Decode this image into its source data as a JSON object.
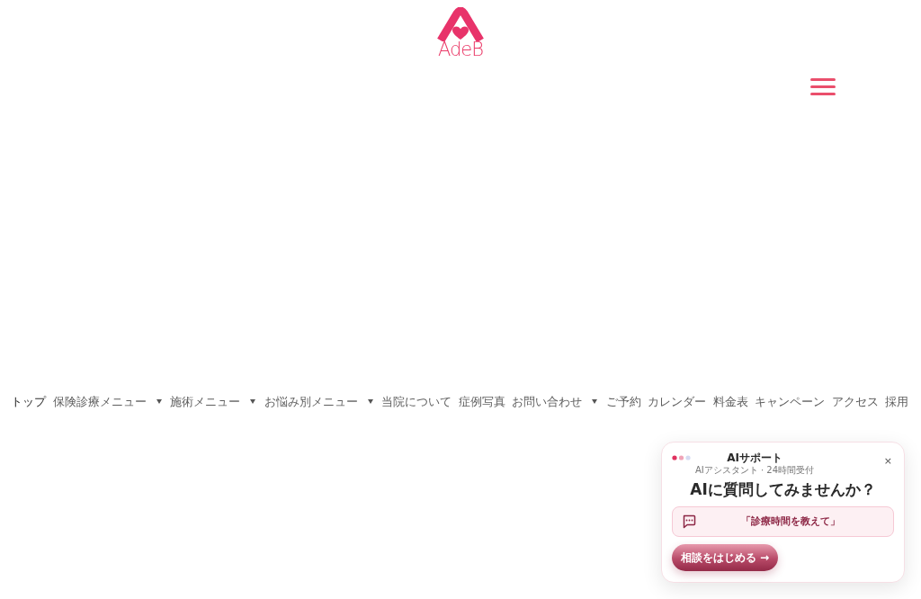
{
  "logo": {
    "text": "AdeB"
  },
  "nav": {
    "items": [
      {
        "label": "トップ",
        "selected": true,
        "dropdown": false
      },
      {
        "label": "保険診療メニュー",
        "selected": false,
        "dropdown": true
      },
      {
        "label": "施術メニュー",
        "selected": false,
        "dropdown": true
      },
      {
        "label": "お悩み別メニュー",
        "selected": false,
        "dropdown": true
      },
      {
        "label": "当院について",
        "selected": false,
        "dropdown": false
      },
      {
        "label": "症例写真",
        "selected": false,
        "dropdown": false
      },
      {
        "label": "お問い合わせ",
        "selected": false,
        "dropdown": true
      },
      {
        "label": "ご予約",
        "selected": false,
        "dropdown": false
      },
      {
        "label": "カレンダー",
        "selected": false,
        "dropdown": false
      },
      {
        "label": "料金表",
        "selected": false,
        "dropdown": false
      },
      {
        "label": "キャンペーン",
        "selected": false,
        "dropdown": false
      },
      {
        "label": "アクセス",
        "selected": false,
        "dropdown": false
      },
      {
        "label": "採用",
        "selected": false,
        "dropdown": false
      }
    ]
  },
  "chat_widget": {
    "title": "AIサポート",
    "subtitle": "AIアシスタント · 24時間受付",
    "close": "×",
    "heading": "AIに質問してみませんか？",
    "suggestion": "「診療時間を教えて」",
    "button": "相談をはじめる →"
  }
}
